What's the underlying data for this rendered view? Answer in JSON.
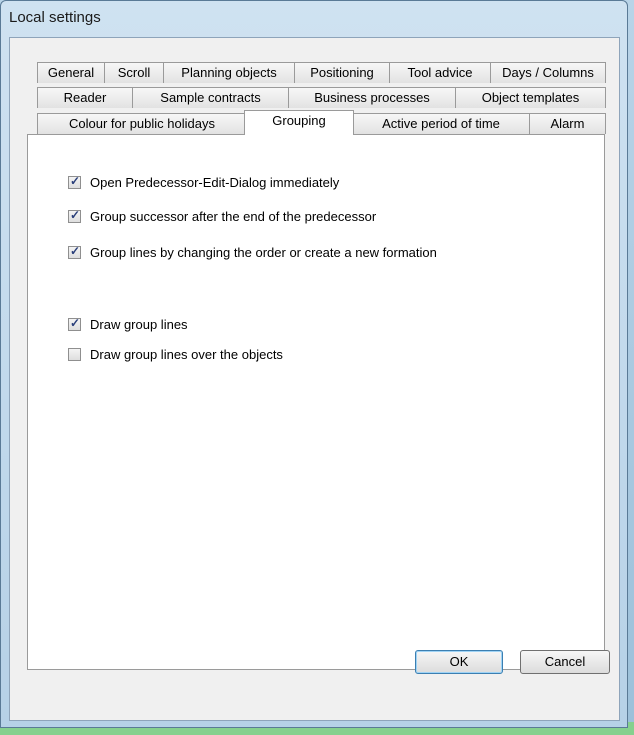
{
  "window": {
    "title": "Local settings"
  },
  "tabs_row1": [
    "General",
    "Scroll",
    "Planning objects",
    "Positioning",
    "Tool advice",
    "Days / Columns"
  ],
  "tabs_row2": [
    "Reader",
    "Sample contracts",
    "Business processes",
    "Object templates"
  ],
  "tabs_row3": [
    "Colour for public holidays",
    "Grouping",
    "Active period of time",
    "Alarm"
  ],
  "active_tab": "Grouping",
  "options": [
    {
      "label": "Open Predecessor-Edit-Dialog immediately",
      "checked": true
    },
    {
      "label": "Group successor after the end of the predecessor",
      "checked": true
    },
    {
      "label": "Group lines by changing the order or create a new formation",
      "checked": true
    },
    {
      "label": "Draw group lines",
      "checked": true
    },
    {
      "label": "Draw group lines over the objects",
      "checked": false
    }
  ],
  "buttons": {
    "ok": "OK",
    "cancel": "Cancel"
  }
}
